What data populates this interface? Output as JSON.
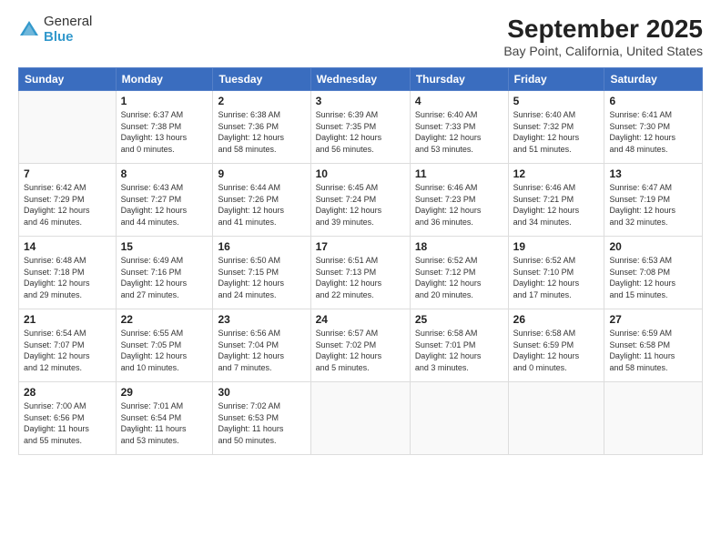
{
  "logo": {
    "general": "General",
    "blue": "Blue"
  },
  "title": "September 2025",
  "subtitle": "Bay Point, California, United States",
  "headers": [
    "Sunday",
    "Monday",
    "Tuesday",
    "Wednesday",
    "Thursday",
    "Friday",
    "Saturday"
  ],
  "weeks": [
    [
      {
        "day": "",
        "info": ""
      },
      {
        "day": "1",
        "info": "Sunrise: 6:37 AM\nSunset: 7:38 PM\nDaylight: 13 hours\nand 0 minutes."
      },
      {
        "day": "2",
        "info": "Sunrise: 6:38 AM\nSunset: 7:36 PM\nDaylight: 12 hours\nand 58 minutes."
      },
      {
        "day": "3",
        "info": "Sunrise: 6:39 AM\nSunset: 7:35 PM\nDaylight: 12 hours\nand 56 minutes."
      },
      {
        "day": "4",
        "info": "Sunrise: 6:40 AM\nSunset: 7:33 PM\nDaylight: 12 hours\nand 53 minutes."
      },
      {
        "day": "5",
        "info": "Sunrise: 6:40 AM\nSunset: 7:32 PM\nDaylight: 12 hours\nand 51 minutes."
      },
      {
        "day": "6",
        "info": "Sunrise: 6:41 AM\nSunset: 7:30 PM\nDaylight: 12 hours\nand 48 minutes."
      }
    ],
    [
      {
        "day": "7",
        "info": "Sunrise: 6:42 AM\nSunset: 7:29 PM\nDaylight: 12 hours\nand 46 minutes."
      },
      {
        "day": "8",
        "info": "Sunrise: 6:43 AM\nSunset: 7:27 PM\nDaylight: 12 hours\nand 44 minutes."
      },
      {
        "day": "9",
        "info": "Sunrise: 6:44 AM\nSunset: 7:26 PM\nDaylight: 12 hours\nand 41 minutes."
      },
      {
        "day": "10",
        "info": "Sunrise: 6:45 AM\nSunset: 7:24 PM\nDaylight: 12 hours\nand 39 minutes."
      },
      {
        "day": "11",
        "info": "Sunrise: 6:46 AM\nSunset: 7:23 PM\nDaylight: 12 hours\nand 36 minutes."
      },
      {
        "day": "12",
        "info": "Sunrise: 6:46 AM\nSunset: 7:21 PM\nDaylight: 12 hours\nand 34 minutes."
      },
      {
        "day": "13",
        "info": "Sunrise: 6:47 AM\nSunset: 7:19 PM\nDaylight: 12 hours\nand 32 minutes."
      }
    ],
    [
      {
        "day": "14",
        "info": "Sunrise: 6:48 AM\nSunset: 7:18 PM\nDaylight: 12 hours\nand 29 minutes."
      },
      {
        "day": "15",
        "info": "Sunrise: 6:49 AM\nSunset: 7:16 PM\nDaylight: 12 hours\nand 27 minutes."
      },
      {
        "day": "16",
        "info": "Sunrise: 6:50 AM\nSunset: 7:15 PM\nDaylight: 12 hours\nand 24 minutes."
      },
      {
        "day": "17",
        "info": "Sunrise: 6:51 AM\nSunset: 7:13 PM\nDaylight: 12 hours\nand 22 minutes."
      },
      {
        "day": "18",
        "info": "Sunrise: 6:52 AM\nSunset: 7:12 PM\nDaylight: 12 hours\nand 20 minutes."
      },
      {
        "day": "19",
        "info": "Sunrise: 6:52 AM\nSunset: 7:10 PM\nDaylight: 12 hours\nand 17 minutes."
      },
      {
        "day": "20",
        "info": "Sunrise: 6:53 AM\nSunset: 7:08 PM\nDaylight: 12 hours\nand 15 minutes."
      }
    ],
    [
      {
        "day": "21",
        "info": "Sunrise: 6:54 AM\nSunset: 7:07 PM\nDaylight: 12 hours\nand 12 minutes."
      },
      {
        "day": "22",
        "info": "Sunrise: 6:55 AM\nSunset: 7:05 PM\nDaylight: 12 hours\nand 10 minutes."
      },
      {
        "day": "23",
        "info": "Sunrise: 6:56 AM\nSunset: 7:04 PM\nDaylight: 12 hours\nand 7 minutes."
      },
      {
        "day": "24",
        "info": "Sunrise: 6:57 AM\nSunset: 7:02 PM\nDaylight: 12 hours\nand 5 minutes."
      },
      {
        "day": "25",
        "info": "Sunrise: 6:58 AM\nSunset: 7:01 PM\nDaylight: 12 hours\nand 3 minutes."
      },
      {
        "day": "26",
        "info": "Sunrise: 6:58 AM\nSunset: 6:59 PM\nDaylight: 12 hours\nand 0 minutes."
      },
      {
        "day": "27",
        "info": "Sunrise: 6:59 AM\nSunset: 6:58 PM\nDaylight: 11 hours\nand 58 minutes."
      }
    ],
    [
      {
        "day": "28",
        "info": "Sunrise: 7:00 AM\nSunset: 6:56 PM\nDaylight: 11 hours\nand 55 minutes."
      },
      {
        "day": "29",
        "info": "Sunrise: 7:01 AM\nSunset: 6:54 PM\nDaylight: 11 hours\nand 53 minutes."
      },
      {
        "day": "30",
        "info": "Sunrise: 7:02 AM\nSunset: 6:53 PM\nDaylight: 11 hours\nand 50 minutes."
      },
      {
        "day": "",
        "info": ""
      },
      {
        "day": "",
        "info": ""
      },
      {
        "day": "",
        "info": ""
      },
      {
        "day": "",
        "info": ""
      }
    ]
  ]
}
